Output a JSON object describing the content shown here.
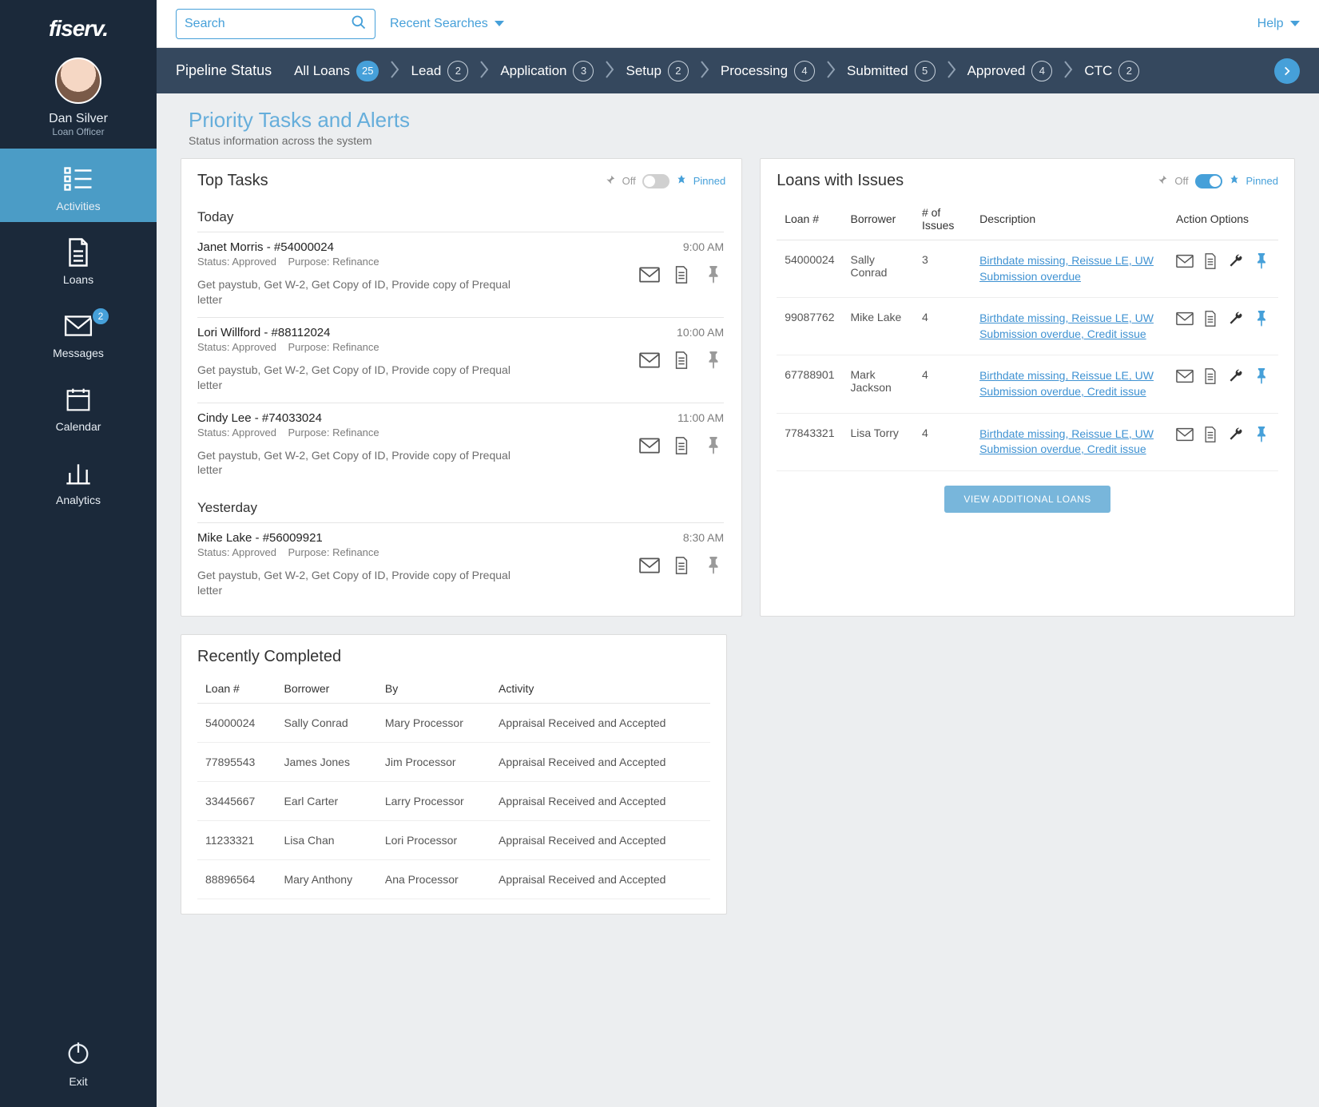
{
  "brand": "fiserv.",
  "profile": {
    "name": "Dan Silver",
    "role": "Loan Officer"
  },
  "nav": {
    "items": [
      {
        "label": "Activities",
        "icon": "list-icon",
        "active": true
      },
      {
        "label": "Loans",
        "icon": "document-icon"
      },
      {
        "label": "Messages",
        "icon": "envelope-icon",
        "badge": "2"
      },
      {
        "label": "Calendar",
        "icon": "calendar-icon"
      },
      {
        "label": "Analytics",
        "icon": "bar-chart-icon"
      }
    ],
    "exit_label": "Exit"
  },
  "topbar": {
    "search_placeholder": "Search",
    "recent_label": "Recent Searches",
    "help_label": "Help"
  },
  "pipeline": {
    "title": "Pipeline Status",
    "stages": [
      {
        "label": "All Loans",
        "count": "25",
        "fill": true
      },
      {
        "label": "Lead",
        "count": "2"
      },
      {
        "label": "Application",
        "count": "3"
      },
      {
        "label": "Setup",
        "count": "2"
      },
      {
        "label": "Processing",
        "count": "4"
      },
      {
        "label": "Submitted",
        "count": "5"
      },
      {
        "label": "Approved",
        "count": "4"
      },
      {
        "label": "CTC",
        "count": "2"
      }
    ]
  },
  "page": {
    "title": "Priority Tasks and Alerts",
    "subtitle": "Status information across the system"
  },
  "panels": {
    "top_tasks": {
      "title": "Top Tasks",
      "off_label": "Off",
      "pinned_label": "Pinned",
      "buckets": [
        {
          "label": "Today",
          "tasks": [
            {
              "title": "Janet Morris - #54000024",
              "time": "9:00 AM",
              "status": "Status: Approved",
              "purpose": "Purpose: Refinance",
              "desc": "Get paystub, Get W-2, Get Copy of ID, Provide copy of Prequal letter"
            },
            {
              "title": "Lori Willford - #88112024",
              "time": "10:00 AM",
              "status": "Status: Approved",
              "purpose": "Purpose: Refinance",
              "desc": "Get paystub, Get W-2, Get Copy of ID, Provide copy of Prequal letter"
            },
            {
              "title": "Cindy Lee - #74033024",
              "time": "11:00 AM",
              "status": "Status: Approved",
              "purpose": "Purpose: Refinance",
              "desc": "Get paystub, Get W-2, Get Copy of ID, Provide copy of Prequal letter"
            }
          ]
        },
        {
          "label": "Yesterday",
          "tasks": [
            {
              "title": "Mike Lake - #56009921",
              "time": "8:30 AM",
              "status": "Status: Approved",
              "purpose": "Purpose: Refinance",
              "desc": "Get paystub, Get W-2, Get Copy of ID, Provide copy of Prequal letter"
            }
          ]
        }
      ]
    },
    "issues": {
      "title": "Loans with Issues",
      "off_label": "Off",
      "pinned_label": "Pinned",
      "columns": [
        "Loan #",
        "Borrower",
        "# of Issues",
        "Description",
        "Action Options"
      ],
      "rows": [
        {
          "loan": "54000024",
          "borrower": "Sally Conrad",
          "count": "3",
          "desc": "Birthdate missing, Reissue LE, UW Submission overdue"
        },
        {
          "loan": "99087762",
          "borrower": "Mike Lake",
          "count": "4",
          "desc": "Birthdate missing, Reissue LE, UW Submission overdue, Credit issue"
        },
        {
          "loan": "67788901",
          "borrower": "Mark Jackson",
          "count": "4",
          "desc": "Birthdate missing, Reissue LE, UW Submission overdue, Credit issue"
        },
        {
          "loan": "77843321",
          "borrower": "Lisa Torry",
          "count": "4",
          "desc": "Birthdate missing, Reissue LE, UW Submission overdue, Credit issue"
        }
      ],
      "view_more": "VIEW ADDITIONAL LOANS"
    },
    "completed": {
      "title": "Recently Completed",
      "columns": [
        "Loan #",
        "Borrower",
        "By",
        "Activity"
      ],
      "rows": [
        {
          "loan": "54000024",
          "borrower": "Sally Conrad",
          "by": "Mary Processor",
          "activity": "Appraisal Received and Accepted"
        },
        {
          "loan": "77895543",
          "borrower": "James Jones",
          "by": "Jim Processor",
          "activity": "Appraisal Received and Accepted"
        },
        {
          "loan": "33445667",
          "borrower": "Earl Carter",
          "by": "Larry Processor",
          "activity": "Appraisal Received and Accepted"
        },
        {
          "loan": "11233321",
          "borrower": "Lisa Chan",
          "by": "Lori Processor",
          "activity": "Appraisal Received and Accepted"
        },
        {
          "loan": "88896564",
          "borrower": "Mary Anthony",
          "by": "Ana Processor",
          "activity": "Appraisal Received and Accepted"
        }
      ]
    }
  }
}
